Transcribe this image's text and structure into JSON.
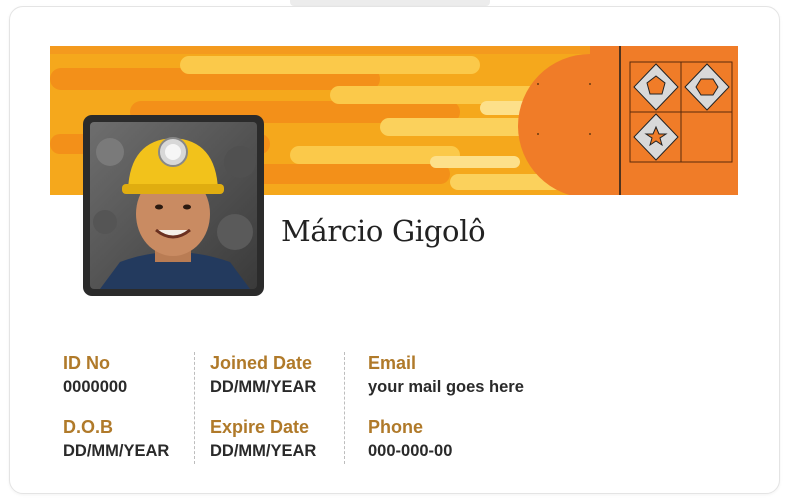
{
  "card": {
    "name": "Márcio Gigolô",
    "fields": {
      "id_no": {
        "label": "ID No",
        "value": "0000000"
      },
      "dob": {
        "label": "D.O.B",
        "value": "DD/MM/YEAR"
      },
      "joined_date": {
        "label": "Joined Date",
        "value": "DD/MM/YEAR"
      },
      "expire_date": {
        "label": "Expire Date",
        "value": "DD/MM/YEAR"
      },
      "email": {
        "label": "Email",
        "value": "your mail goes here"
      },
      "phone": {
        "label": "Phone",
        "value": "000-000-00"
      }
    }
  },
  "colors": {
    "banner_yellow": "#f5a81c",
    "banner_orange": "#f07c28",
    "label_gold": "#b07a2a",
    "value_text": "#2a2a2a"
  },
  "icons": [
    "pentagon-icon",
    "hexagon-icon",
    "star-icon"
  ]
}
